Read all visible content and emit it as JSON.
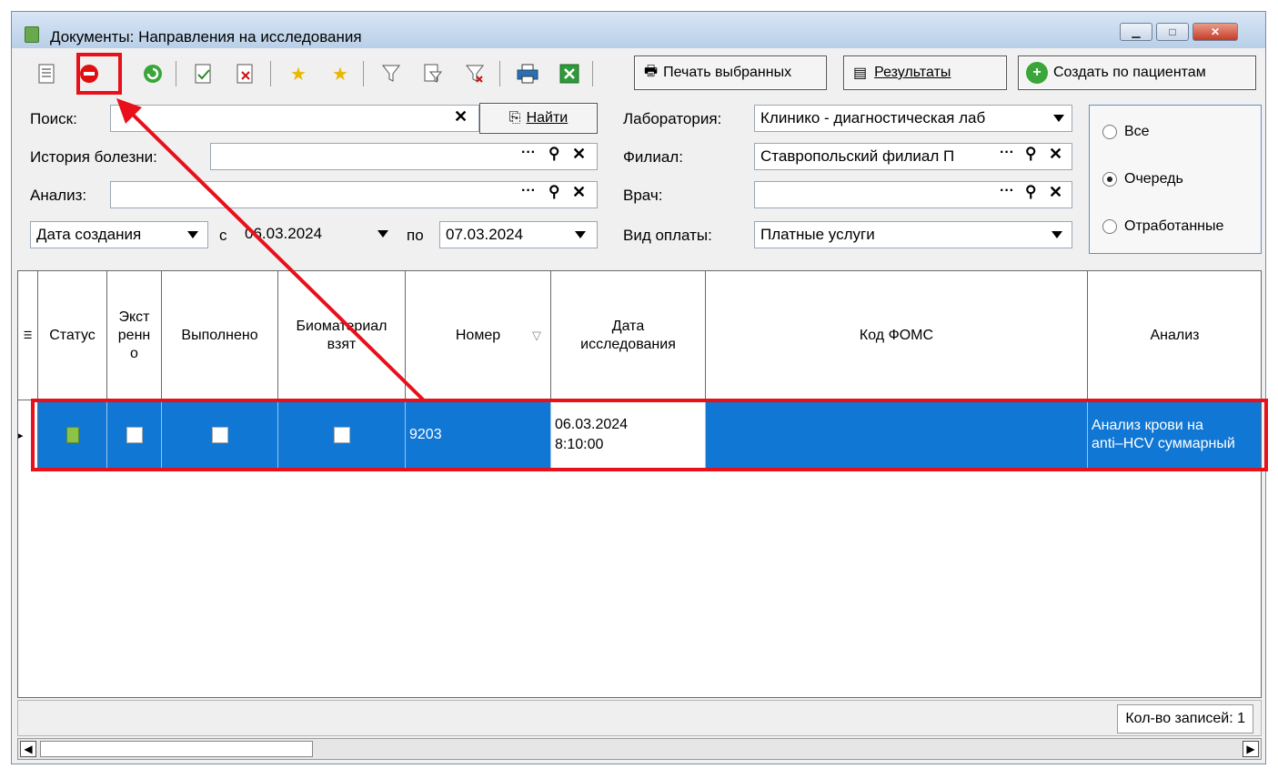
{
  "window": {
    "title": "Документы: Направления на исследования"
  },
  "toolbar": {
    "print_selected_label": "Печать выбранных",
    "results_label": "Результаты",
    "create_by_patients_label": "Создать по пациентам",
    "icons": [
      "document-list-icon",
      "stop-icon",
      "refresh-icon",
      "document-check-icon",
      "document-delete-icon",
      "star-add-icon",
      "star-icon",
      "filter-icon",
      "filter-edit-icon",
      "filter-clear-icon",
      "print-icon",
      "excel-export-icon"
    ]
  },
  "filters": {
    "search_label": "Поиск:",
    "search_value": "",
    "find_button": "Найти",
    "history_label": "История болезни:",
    "history_value": "",
    "analysis_label": "Анализ:",
    "analysis_value": "",
    "date_type": "Дата создания",
    "from_label": "с",
    "from_date": "06.03.2024",
    "to_label": "по",
    "to_date": "07.03.2024",
    "lab_label": "Лаборатория:",
    "lab_value": "Клинико - диагностическая лаб",
    "branch_label": "Филиал:",
    "branch_value": "Ставропольский филиал П",
    "doctor_label": "Врач:",
    "doctor_value": "",
    "payment_label": "Вид оплаты:",
    "payment_value": "Платные услуги"
  },
  "radio": {
    "all": "Все",
    "queue": "Очередь",
    "done": "Отработанные",
    "selected": "queue"
  },
  "grid": {
    "columns": {
      "status": "Статус",
      "urgent": "Экстренно",
      "urgent_lines": [
        "Экст",
        "ренн",
        "о"
      ],
      "completed": "Выполнено",
      "biomaterial_lines": [
        "Биоматериал",
        "взят"
      ],
      "number": "Номер",
      "research_date_lines": [
        "Дата",
        "исследования"
      ],
      "foms_code": "Код ФОМС",
      "analysis": "Анализ"
    },
    "rows": [
      {
        "number": "9203",
        "date_line1": "06.03.2024",
        "date_line2": "8:10:00",
        "foms_code": "",
        "analysis_line1": "Анализ крови на",
        "analysis_line2": "anti–HCV суммарный",
        "urgent": false,
        "completed": false,
        "biomaterial": false
      }
    ]
  },
  "status": {
    "records_count": "Кол-во записей: 1"
  },
  "colors": {
    "selection": "#1177d4",
    "annotation": "#e8101a"
  }
}
